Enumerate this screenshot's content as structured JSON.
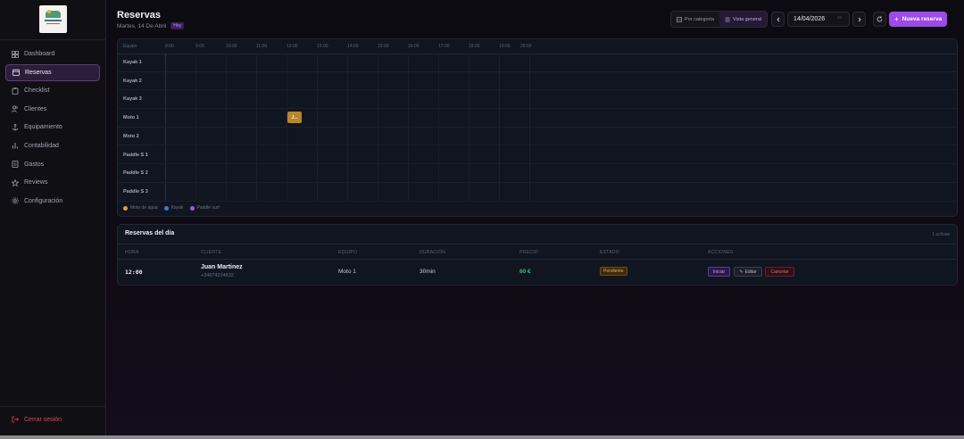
{
  "sidebar": {
    "items": [
      {
        "label": "Dashboard",
        "icon": "dashboard-icon",
        "active": false
      },
      {
        "label": "Reservas",
        "icon": "calendar-icon",
        "active": true
      },
      {
        "label": "Checklist",
        "icon": "clipboard-icon",
        "active": false
      },
      {
        "label": "Clientes",
        "icon": "users-icon",
        "active": false
      },
      {
        "label": "Equipamiento",
        "icon": "anchor-icon",
        "active": false
      },
      {
        "label": "Contabilidad",
        "icon": "bar-chart-icon",
        "active": false
      },
      {
        "label": "Gastos",
        "icon": "receipt-icon",
        "active": false
      },
      {
        "label": "Reviews",
        "icon": "star-icon",
        "active": false
      },
      {
        "label": "Configuración",
        "icon": "gear-icon",
        "active": false
      }
    ],
    "logout_label": "Cerrar sesión"
  },
  "header": {
    "title": "Reservas",
    "subtitle": "Martes, 14 De Abril",
    "today_badge": "Hoy",
    "view_by_category": "Por categoría",
    "view_overview": "Vista general",
    "date_value": "14/04/2026",
    "new_booking": "Nueva reserva"
  },
  "timeline": {
    "equipment_header": "Equipo",
    "hours": [
      "8:00",
      "9:00",
      "10:00",
      "11:00",
      "12:00",
      "13:00",
      "14:00",
      "15:00",
      "16:00",
      "17:00",
      "18:00",
      "19:00",
      "20:00"
    ],
    "resources": [
      "Kayak 1",
      "Kayak 2",
      "Kayak 3",
      "Moto 1",
      "Moto 2",
      "Paddle S 1",
      "Paddle S 2",
      "Paddle S 3"
    ],
    "booking": {
      "label": "J...",
      "resource": "Moto 1",
      "start": "12:00",
      "duration": "30min"
    },
    "legend": [
      {
        "label": "Moto de agua",
        "color": "#e0a33a"
      },
      {
        "label": "Kayak",
        "color": "#3b7be6"
      },
      {
        "label": "Paddle surf",
        "color": "#a05ae6"
      }
    ]
  },
  "day": {
    "title": "Reservas del día",
    "count": "1 activas",
    "columns": [
      "HORA",
      "CLIENTE",
      "EQUIPO",
      "DURACIÓN",
      "PRECIO",
      "ESTADO",
      "ACCIONES"
    ],
    "rows": [
      {
        "time": "12:00",
        "client": "Juan Martinez",
        "phone": "+34674224832",
        "equipment": "Moto 1",
        "duration": "30min",
        "price": "60 €",
        "status": "Pendiente",
        "actions": {
          "start": "Iniciar",
          "edit": "Editar",
          "cancel": "Cancelar"
        }
      }
    ]
  },
  "colors": {
    "accent": "#9d4be8",
    "moto": "#b9862c",
    "price": "#35c27a",
    "danger": "#e5484d"
  }
}
